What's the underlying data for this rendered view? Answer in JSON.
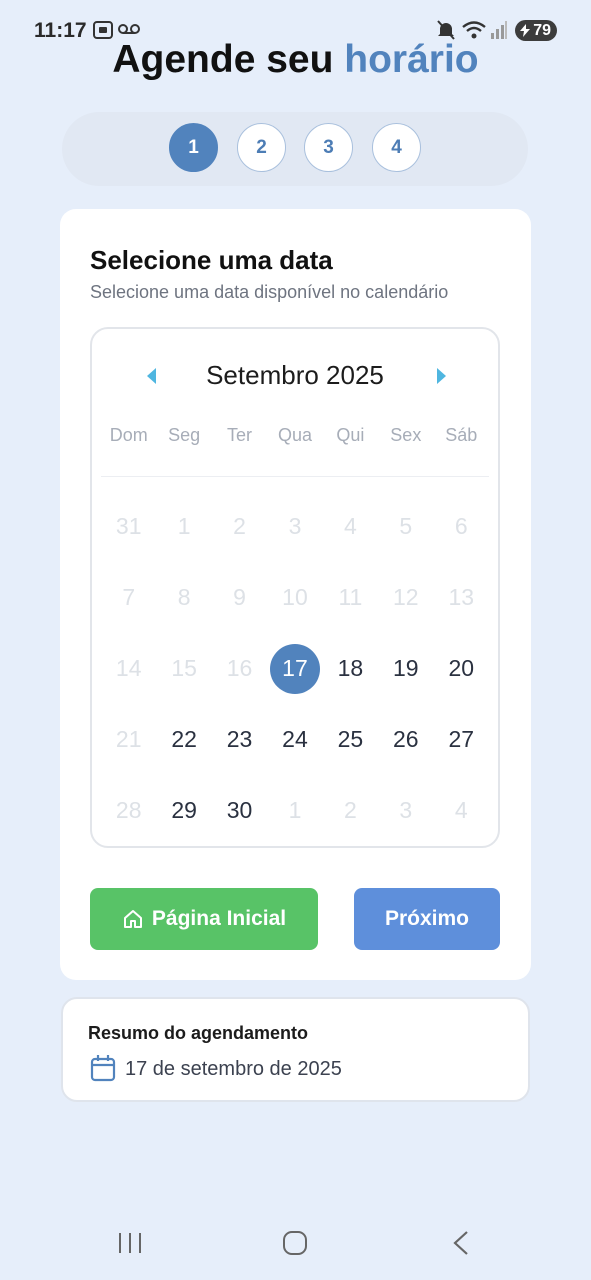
{
  "status_bar": {
    "time": "11:17",
    "battery": "79",
    "icons": [
      "screenshot-icon",
      "voicemail-icon",
      "mute-icon",
      "wifi-icon",
      "signal-icon",
      "battery-icon"
    ]
  },
  "title": {
    "main": "Agende seu ",
    "accent": "horário"
  },
  "stepper": {
    "steps": [
      "1",
      "2",
      "3",
      "4"
    ],
    "active_step": "1"
  },
  "card": {
    "title": "Selecione uma data",
    "subtitle": "Selecione uma data disponível no calendário"
  },
  "calendar": {
    "month": "Setembro 2025",
    "weekdays": [
      "Dom",
      "Seg",
      "Ter",
      "Qua",
      "Qui",
      "Sex",
      "Sáb"
    ],
    "selected": "17",
    "weeks": [
      [
        {
          "d": "31",
          "s": "disabled"
        },
        {
          "d": "1",
          "s": "disabled"
        },
        {
          "d": "2",
          "s": "disabled"
        },
        {
          "d": "3",
          "s": "disabled"
        },
        {
          "d": "4",
          "s": "disabled"
        },
        {
          "d": "5",
          "s": "disabled"
        },
        {
          "d": "6",
          "s": "disabled"
        }
      ],
      [
        {
          "d": "7",
          "s": "disabled"
        },
        {
          "d": "8",
          "s": "disabled"
        },
        {
          "d": "9",
          "s": "disabled"
        },
        {
          "d": "10",
          "s": "disabled"
        },
        {
          "d": "11",
          "s": "disabled"
        },
        {
          "d": "12",
          "s": "disabled"
        },
        {
          "d": "13",
          "s": "disabled"
        }
      ],
      [
        {
          "d": "14",
          "s": "disabled"
        },
        {
          "d": "15",
          "s": "disabled"
        },
        {
          "d": "16",
          "s": "disabled"
        },
        {
          "d": "17",
          "s": "selected"
        },
        {
          "d": "18",
          "s": "available"
        },
        {
          "d": "19",
          "s": "available"
        },
        {
          "d": "20",
          "s": "available"
        }
      ],
      [
        {
          "d": "21",
          "s": "disabled"
        },
        {
          "d": "22",
          "s": "available"
        },
        {
          "d": "23",
          "s": "available"
        },
        {
          "d": "24",
          "s": "available"
        },
        {
          "d": "25",
          "s": "available"
        },
        {
          "d": "26",
          "s": "available"
        },
        {
          "d": "27",
          "s": "available"
        }
      ],
      [
        {
          "d": "28",
          "s": "disabled"
        },
        {
          "d": "29",
          "s": "available"
        },
        {
          "d": "30",
          "s": "available"
        },
        {
          "d": "1",
          "s": "disabled"
        },
        {
          "d": "2",
          "s": "disabled"
        },
        {
          "d": "3",
          "s": "disabled"
        },
        {
          "d": "4",
          "s": "disabled"
        }
      ]
    ]
  },
  "buttons": {
    "home_label": "Página Inicial",
    "next_label": "Próximo"
  },
  "summary": {
    "title": "Resumo do agendamento",
    "date": "17 de setembro de 2025"
  },
  "colors": {
    "accent": "#5183bd",
    "home_button": "#58c367",
    "next_button": "#5e8fdb",
    "background": "#e6eefa"
  }
}
